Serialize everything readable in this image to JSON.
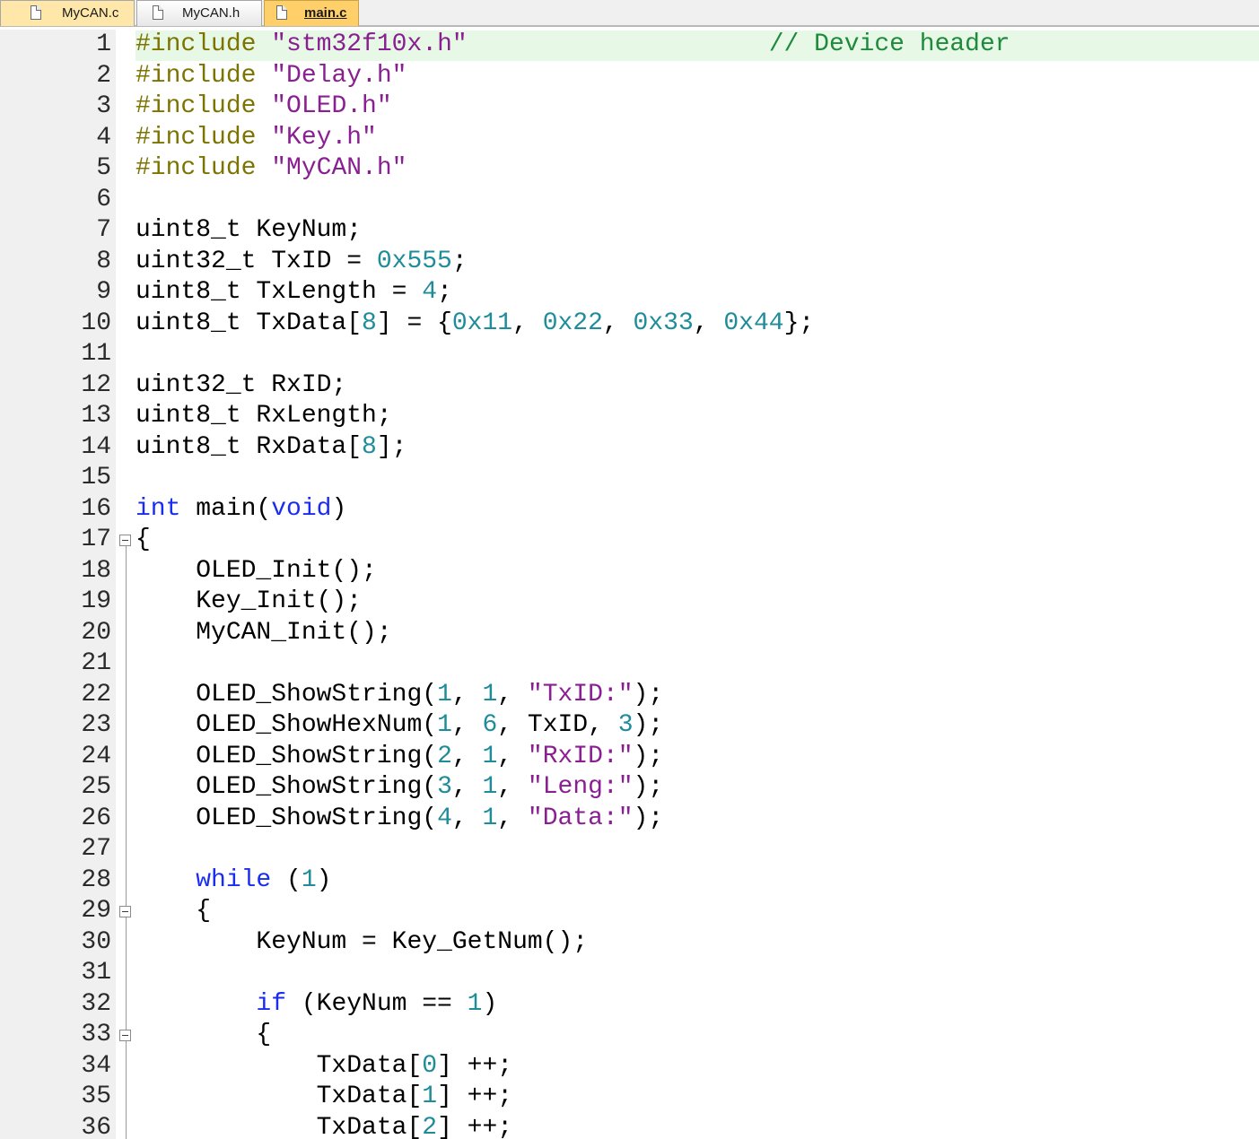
{
  "tabs": [
    {
      "label": "MyCAN.c",
      "active": false
    },
    {
      "label": "MyCAN.h",
      "active": false
    },
    {
      "label": "main.c",
      "active": true
    }
  ],
  "editor": {
    "current_line": 1,
    "colors": {
      "preprocessor": "#7c7400",
      "string": "#8a1f92",
      "number": "#1f8c9a",
      "keyword": "#1a2cf0",
      "comment": "#1e8a3c",
      "current_line_bg": "#e7f8e7",
      "gutter_bg": "#f0f0f0"
    },
    "lines": [
      {
        "n": "1",
        "tokens": [
          [
            "pp",
            "#include "
          ],
          [
            "str",
            "\"stm32f10x.h\""
          ],
          [
            "plain",
            "                    "
          ],
          [
            "cm",
            "// Device header"
          ]
        ]
      },
      {
        "n": "2",
        "tokens": [
          [
            "pp",
            "#include "
          ],
          [
            "str",
            "\"Delay.h\""
          ]
        ]
      },
      {
        "n": "3",
        "tokens": [
          [
            "pp",
            "#include "
          ],
          [
            "str",
            "\"OLED.h\""
          ]
        ]
      },
      {
        "n": "4",
        "tokens": [
          [
            "pp",
            "#include "
          ],
          [
            "str",
            "\"Key.h\""
          ]
        ]
      },
      {
        "n": "5",
        "tokens": [
          [
            "pp",
            "#include "
          ],
          [
            "str",
            "\"MyCAN.h\""
          ]
        ]
      },
      {
        "n": "6",
        "tokens": []
      },
      {
        "n": "7",
        "tokens": [
          [
            "plain",
            "uint8_t KeyNum;"
          ]
        ]
      },
      {
        "n": "8",
        "tokens": [
          [
            "plain",
            "uint32_t TxID = "
          ],
          [
            "num",
            "0x555"
          ],
          [
            "plain",
            ";"
          ]
        ]
      },
      {
        "n": "9",
        "tokens": [
          [
            "plain",
            "uint8_t TxLength = "
          ],
          [
            "num",
            "4"
          ],
          [
            "plain",
            ";"
          ]
        ]
      },
      {
        "n": "10",
        "tokens": [
          [
            "plain",
            "uint8_t TxData["
          ],
          [
            "num",
            "8"
          ],
          [
            "plain",
            "] = {"
          ],
          [
            "num",
            "0x11"
          ],
          [
            "plain",
            ", "
          ],
          [
            "num",
            "0x22"
          ],
          [
            "plain",
            ", "
          ],
          [
            "num",
            "0x33"
          ],
          [
            "plain",
            ", "
          ],
          [
            "num",
            "0x44"
          ],
          [
            "plain",
            "};"
          ]
        ]
      },
      {
        "n": "11",
        "tokens": []
      },
      {
        "n": "12",
        "tokens": [
          [
            "plain",
            "uint32_t RxID;"
          ]
        ]
      },
      {
        "n": "13",
        "tokens": [
          [
            "plain",
            "uint8_t RxLength;"
          ]
        ]
      },
      {
        "n": "14",
        "tokens": [
          [
            "plain",
            "uint8_t RxData["
          ],
          [
            "num",
            "8"
          ],
          [
            "plain",
            "];"
          ]
        ]
      },
      {
        "n": "15",
        "tokens": []
      },
      {
        "n": "16",
        "tokens": [
          [
            "kw",
            "int"
          ],
          [
            "plain",
            " main("
          ],
          [
            "kw",
            "void"
          ],
          [
            "plain",
            ")"
          ]
        ]
      },
      {
        "n": "17",
        "tokens": [
          [
            "plain",
            "{"
          ]
        ]
      },
      {
        "n": "18",
        "tokens": [
          [
            "plain",
            "    OLED_Init();"
          ]
        ]
      },
      {
        "n": "19",
        "tokens": [
          [
            "plain",
            "    Key_Init();"
          ]
        ]
      },
      {
        "n": "20",
        "tokens": [
          [
            "plain",
            "    MyCAN_Init();"
          ]
        ]
      },
      {
        "n": "21",
        "tokens": []
      },
      {
        "n": "22",
        "tokens": [
          [
            "plain",
            "    OLED_ShowString("
          ],
          [
            "num",
            "1"
          ],
          [
            "plain",
            ", "
          ],
          [
            "num",
            "1"
          ],
          [
            "plain",
            ", "
          ],
          [
            "str",
            "\"TxID:\""
          ],
          [
            "plain",
            ");"
          ]
        ]
      },
      {
        "n": "23",
        "tokens": [
          [
            "plain",
            "    OLED_ShowHexNum("
          ],
          [
            "num",
            "1"
          ],
          [
            "plain",
            ", "
          ],
          [
            "num",
            "6"
          ],
          [
            "plain",
            ", TxID, "
          ],
          [
            "num",
            "3"
          ],
          [
            "plain",
            ");"
          ]
        ]
      },
      {
        "n": "24",
        "tokens": [
          [
            "plain",
            "    OLED_ShowString("
          ],
          [
            "num",
            "2"
          ],
          [
            "plain",
            ", "
          ],
          [
            "num",
            "1"
          ],
          [
            "plain",
            ", "
          ],
          [
            "str",
            "\"RxID:\""
          ],
          [
            "plain",
            ");"
          ]
        ]
      },
      {
        "n": "25",
        "tokens": [
          [
            "plain",
            "    OLED_ShowString("
          ],
          [
            "num",
            "3"
          ],
          [
            "plain",
            ", "
          ],
          [
            "num",
            "1"
          ],
          [
            "plain",
            ", "
          ],
          [
            "str",
            "\"Leng:\""
          ],
          [
            "plain",
            ");"
          ]
        ]
      },
      {
        "n": "26",
        "tokens": [
          [
            "plain",
            "    OLED_ShowString("
          ],
          [
            "num",
            "4"
          ],
          [
            "plain",
            ", "
          ],
          [
            "num",
            "1"
          ],
          [
            "plain",
            ", "
          ],
          [
            "str",
            "\"Data:\""
          ],
          [
            "plain",
            ");"
          ]
        ]
      },
      {
        "n": "27",
        "tokens": []
      },
      {
        "n": "28",
        "tokens": [
          [
            "plain",
            "    "
          ],
          [
            "kw",
            "while"
          ],
          [
            "plain",
            " ("
          ],
          [
            "num",
            "1"
          ],
          [
            "plain",
            ")"
          ]
        ]
      },
      {
        "n": "29",
        "tokens": [
          [
            "plain",
            "    {"
          ]
        ]
      },
      {
        "n": "30",
        "tokens": [
          [
            "plain",
            "        KeyNum = Key_GetNum();"
          ]
        ]
      },
      {
        "n": "31",
        "tokens": []
      },
      {
        "n": "32",
        "tokens": [
          [
            "plain",
            "        "
          ],
          [
            "kw",
            "if"
          ],
          [
            "plain",
            " (KeyNum == "
          ],
          [
            "num",
            "1"
          ],
          [
            "plain",
            ")"
          ]
        ]
      },
      {
        "n": "33",
        "tokens": [
          [
            "plain",
            "        {"
          ]
        ]
      },
      {
        "n": "34",
        "tokens": [
          [
            "plain",
            "            TxData["
          ],
          [
            "num",
            "0"
          ],
          [
            "plain",
            "] ++;"
          ]
        ]
      },
      {
        "n": "35",
        "tokens": [
          [
            "plain",
            "            TxData["
          ],
          [
            "num",
            "1"
          ],
          [
            "plain",
            "] ++;"
          ]
        ]
      },
      {
        "n": "36",
        "tokens": [
          [
            "plain",
            "            TxData["
          ],
          [
            "num",
            "2"
          ],
          [
            "plain",
            "] ++;"
          ]
        ]
      }
    ]
  }
}
